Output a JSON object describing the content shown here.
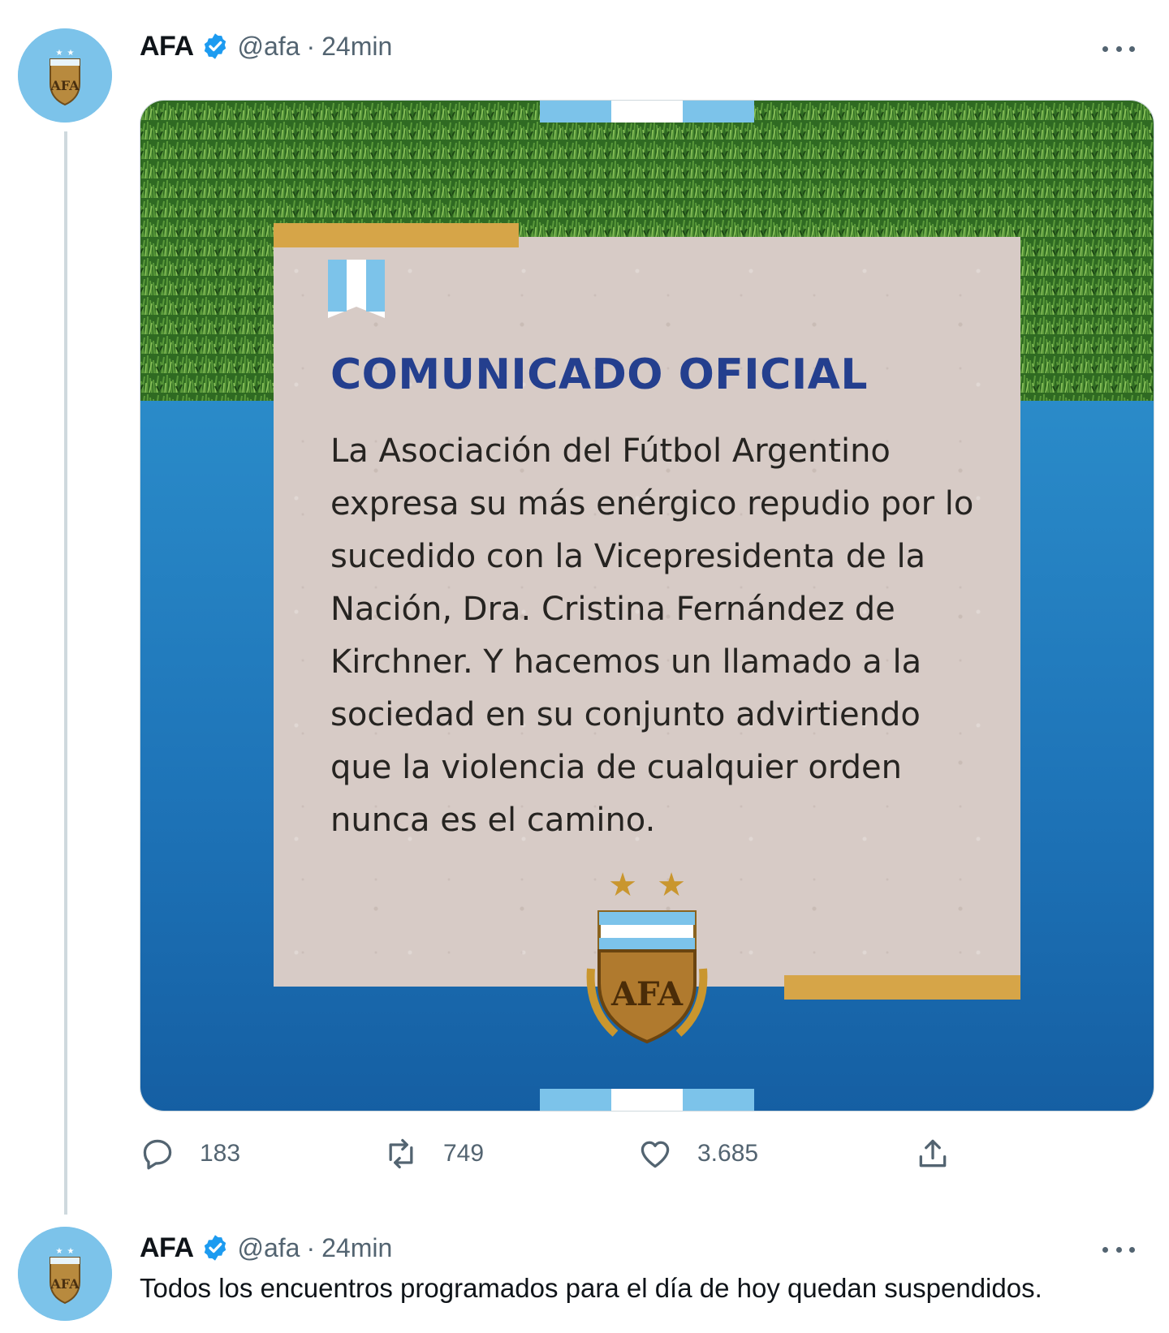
{
  "tweets": [
    {
      "author": {
        "name": "AFA",
        "handle": "@afa",
        "verified": true
      },
      "separator": "·",
      "time": "24min",
      "media": {
        "title": "COMUNICADO OFICIAL",
        "body": "La Asociación del Fútbol Argentino expresa su más enérgico repudio por lo sucedido con la Vicepresidenta de la Nación, Dra. Cristina Fernández de Kirchner. Y hacemos un llamado a la sociedad en su conjunto advirtiendo que la violencia de cualquier orden nunca es el camino.",
        "crest_text": "AFA"
      },
      "actions": {
        "replies": "183",
        "retweets": "749",
        "likes": "3.685"
      }
    },
    {
      "author": {
        "name": "AFA",
        "handle": "@afa",
        "verified": true
      },
      "separator": "·",
      "time": "24min",
      "text": "Todos los encuentros programados para el día de hoy quedan suspendidos."
    }
  ],
  "colors": {
    "verified_blue": "#1d9bf0",
    "text_secondary": "#536471",
    "title_blue": "#243f8e",
    "gold": "#d6a548",
    "sky_blue": "#7cc3ea"
  },
  "icons": [
    "verified-icon",
    "more-icon",
    "reply-icon",
    "retweet-icon",
    "like-icon",
    "share-icon",
    "ribbon-icon",
    "crest-icon"
  ]
}
